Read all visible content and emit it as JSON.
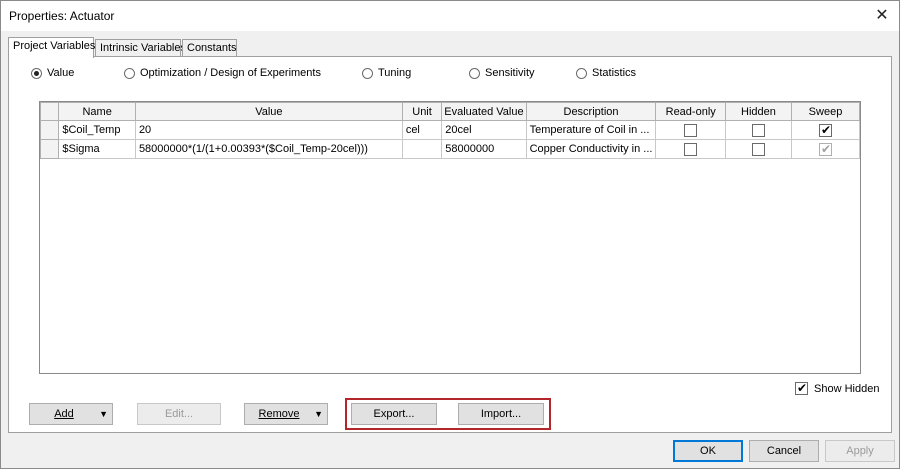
{
  "window": {
    "title": "Properties: Actuator",
    "close_glyph": "✕"
  },
  "tabs": [
    {
      "label": "Project Variables",
      "active": true
    },
    {
      "label": "Intrinsic Variables",
      "active": false
    },
    {
      "label": "Constants",
      "active": false
    }
  ],
  "modes": [
    {
      "label": "Value",
      "checked": true
    },
    {
      "label": "Optimization / Design of Experiments",
      "checked": false
    },
    {
      "label": "Tuning",
      "checked": false
    },
    {
      "label": "Sensitivity",
      "checked": false
    },
    {
      "label": "Statistics",
      "checked": false
    }
  ],
  "grid": {
    "columns": [
      "Name",
      "Value",
      "Unit",
      "Evaluated Value",
      "Description",
      "Read-only",
      "Hidden",
      "Sweep"
    ],
    "rows": [
      {
        "name": "$Coil_Temp",
        "value": "20",
        "unit": "cel",
        "evaluated": "20cel",
        "description": "Temperature of Coil in ...",
        "read_only": false,
        "hidden": false,
        "sweep": true,
        "sweep_enabled": true
      },
      {
        "name": "$Sigma",
        "value": "58000000*(1/(1+0.00393*($Coil_Temp-20cel)))",
        "unit": "",
        "evaluated": "58000000",
        "description": "Copper Conductivity in ...",
        "read_only": false,
        "hidden": false,
        "sweep": true,
        "sweep_enabled": false
      }
    ]
  },
  "show_hidden": {
    "label": "Show Hidden",
    "checked": true
  },
  "buttons": {
    "add": "Add",
    "edit": "Edit...",
    "remove": "Remove",
    "export": "Export...",
    "import": "Import...",
    "ok": "OK",
    "cancel": "Cancel",
    "apply": "Apply"
  },
  "icons": {
    "check_glyph": "✔",
    "dropdown_glyph": "▼"
  },
  "colors": {
    "highlight": "#b3262a",
    "default_button_border": "#0078d7"
  }
}
